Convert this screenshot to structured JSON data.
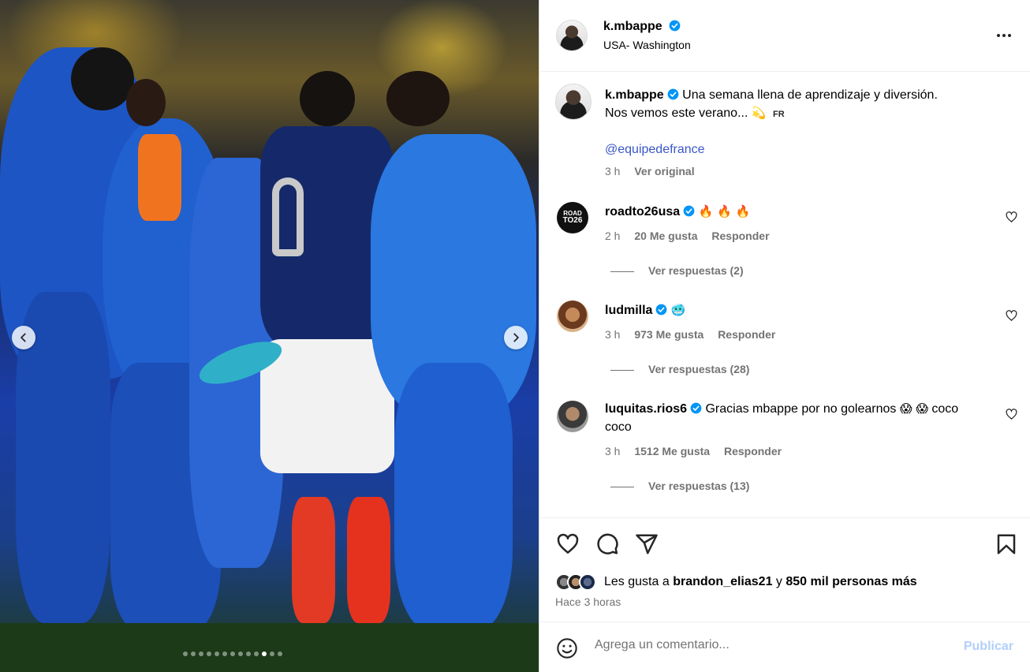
{
  "post": {
    "author": "k.mbappe",
    "location": "USA- Washington",
    "caption_line1": "Una semana llena de aprendizaje y diversión.",
    "caption_line2": "Nos vemos este verano...",
    "caption_emoji": "💫",
    "lang_tag": "FR",
    "mention": "@equipedefrance",
    "caption_time": "3 h",
    "see_original": "Ver original"
  },
  "media": {
    "image_description_icon": "photo-carousel",
    "dot_count": 13,
    "active_dot_index": 10,
    "prev_icon": "chevron-left-icon",
    "next_icon": "chevron-right-icon"
  },
  "comments": [
    {
      "user": "roadto26usa",
      "avatar_text_line1": "ROAD",
      "avatar_text_line2": "TO26",
      "text": "🔥 🔥 🔥",
      "time": "2 h",
      "likes": "20 Me gusta",
      "reply": "Responder",
      "replies": "Ver respuestas (2)"
    },
    {
      "user": "ludmilla",
      "text": "🥶",
      "time": "3 h",
      "likes": "973 Me gusta",
      "reply": "Responder",
      "replies": "Ver respuestas (28)"
    },
    {
      "user": "luquitas.rios6",
      "text_part1": "Gracias mbappe por no golearnos",
      "text_emojis": "😱 😱",
      "text_part2": "coco",
      "text_line2": "coco",
      "time": "3 h",
      "likes": "1512 Me gusta",
      "reply": "Responder",
      "replies": "Ver respuestas (13)"
    }
  ],
  "actions": {
    "likes_prefix": "Les gusta a",
    "likes_user": "brandon_elias21",
    "likes_mid": "y",
    "likes_count": "850 mil personas más",
    "time_ago": "Hace 3 horas"
  },
  "comment_box": {
    "placeholder": "Agrega un comentario...",
    "publish": "Publicar"
  },
  "colors": {
    "verified": "#0095f6",
    "link": "#3a57c8",
    "muted": "#737373",
    "publish_disabled": "#b2cffa"
  }
}
